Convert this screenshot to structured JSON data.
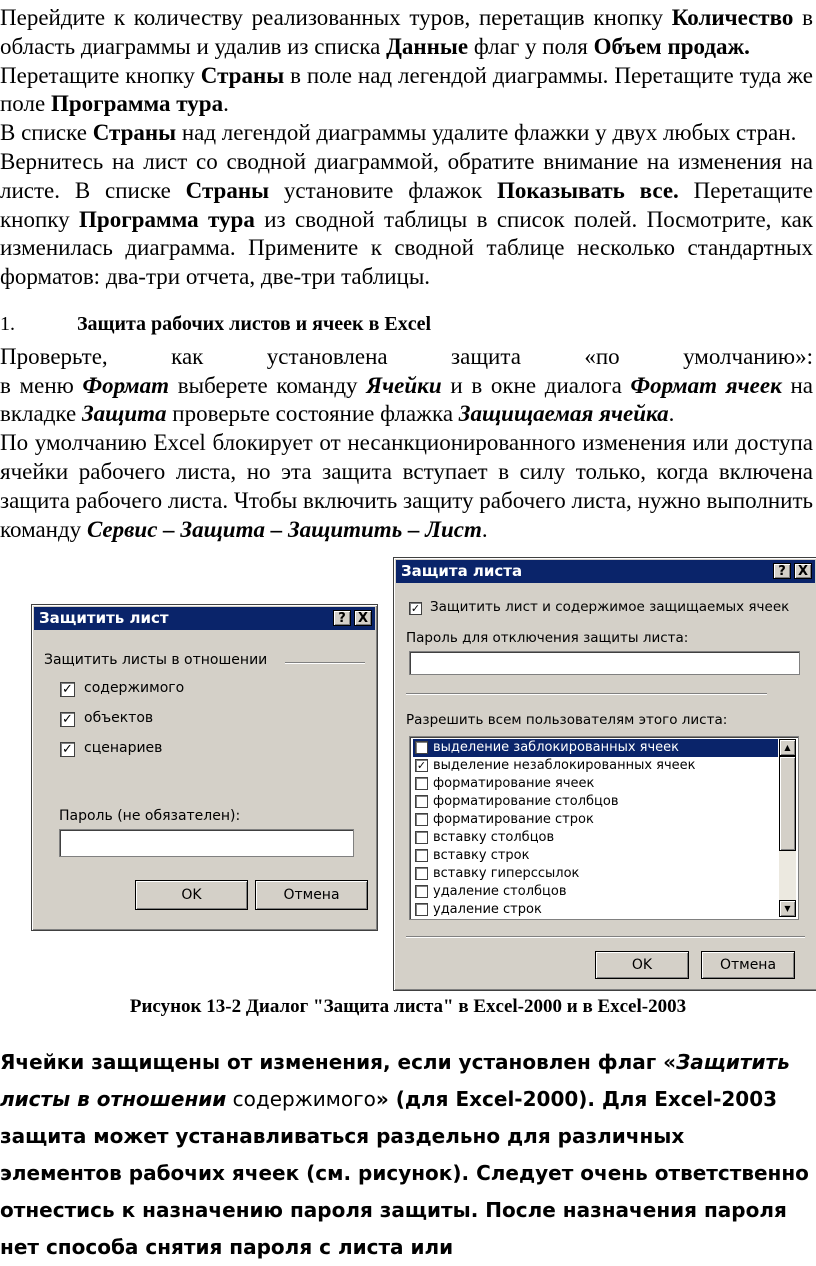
{
  "text": {
    "p1": {
      "a": "Перейдите к количеству реализованных туров, перетащив кнопку ",
      "b": "Количество",
      "c": " в область диаграммы и удалив из списка ",
      "d": "Данные",
      "e": " флаг у поля ",
      "f": "Объем продаж."
    },
    "p2": {
      "a": "Перетащите кнопку ",
      "b": "Страны",
      "c": " в поле над легендой диаграммы. Перетащите туда же поле ",
      "d": "Программа тура",
      "e": "."
    },
    "p3": {
      "a": "В списке ",
      "b": "Страны",
      "c": " над легендой диаграммы удалите флажки у двух любых стран."
    },
    "p4": {
      "a": "Вернитесь на лист со сводной диаграммой, обратите внимание на изменения на листе. В списке ",
      "b": "Страны",
      "c": " установите флажок ",
      "d": "Показывать все.",
      "e": " Перетащите кнопку ",
      "f": "Программа тура",
      "g": " из сводной таблицы в список полей. Посмотрите, как изменилась диаграмма. Примените к сводной таблице несколько стандартных форматов: два-три отчета, две-три таблицы."
    },
    "heading": {
      "num": "1.",
      "title": "Защита рабочих листов и ячеек в Excel"
    },
    "p5a": "Проверьте, как установлена защита «по умолчанию»:",
    "p5b": {
      "a": "в меню ",
      "b": "Формат",
      "c": " выберете команду ",
      "d": "Ячейки",
      "e": " и в окне диалога ",
      "f": "Формат ячеек",
      "g": " на вкладке ",
      "h": "Защита",
      "i": " проверьте состояние флажка ",
      "j": "Защищаемая ячейка",
      "k": "."
    },
    "p6": {
      "a": "По умолчанию Excel блокирует от несанкционированного изменения или доступа ячейки рабочего листа, но эта защита вступает в силу только, когда включена защита рабочего листа. Чтобы включить защиту рабочего листа, нужно выполнить команду ",
      "b": "Сервис – Защита – Защитить – Лист",
      "c": "."
    }
  },
  "dialog2000": {
    "title": "Защитить лист",
    "help": "?",
    "close": "X",
    "group": "Защитить листы в отношении",
    "options": [
      "содержимого",
      "объектов",
      "сценариев"
    ],
    "check": "✓",
    "password_label": "Пароль (не обязателен):",
    "ok": "OK",
    "cancel": "Отмена"
  },
  "dialog2003": {
    "title": "Защита листа",
    "help": "?",
    "close": "X",
    "protect_label": "Защитить лист и содержимое защищаемых ячеек",
    "password_label": "Пароль для отключения защиты листа:",
    "allow_label": "Разрешить всем пользователям этого листа:",
    "items": [
      "выделение заблокированных ячеек",
      "выделение незаблокированных ячеек",
      "форматирование ячеек",
      "форматирование столбцов",
      "форматирование строк",
      "вставку столбцов",
      "вставку строк",
      "вставку гиперссылок",
      "удаление столбцов",
      "удаление строк"
    ],
    "checked": [
      true,
      true,
      false,
      false,
      false,
      false,
      false,
      false,
      false,
      false
    ],
    "check": "✓",
    "scroll_up": "▲",
    "scroll_down": "▼",
    "ok": "OK",
    "cancel": "Отмена"
  },
  "caption": "Рисунок 13-2 Диалог \"Защита листа\" в Excel-2000 и в Excel-2003",
  "text2": {
    "a": "Ячейки защищены от изменения, если установлен флаг «",
    "b": "Защитить листы в отношении",
    "c": " содержимого",
    "d": "» (для Excel-2000). Для Excel-2003 защита может устанавливаться раздельно для различных элементов рабочих ячеек (см. рисунок). Следует очень ответственно отнестись к назначению пароля защиты. После назначения пароля нет способа снятия пароля с листа или"
  }
}
